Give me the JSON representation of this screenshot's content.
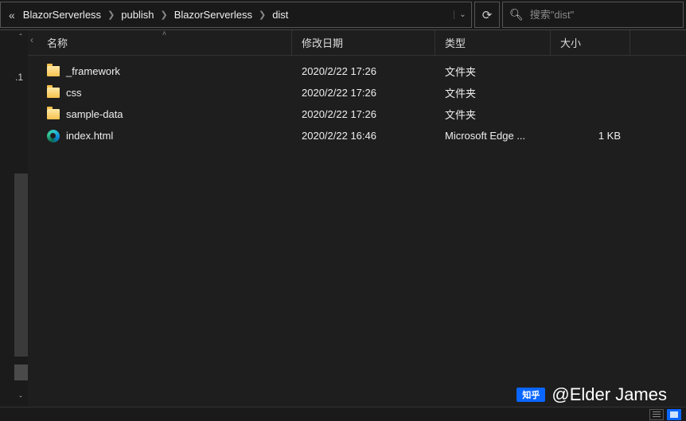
{
  "breadcrumb": {
    "overflow": "«",
    "items": [
      "BlazorServerless",
      "publish",
      "BlazorServerless",
      "dist"
    ]
  },
  "search": {
    "placeholder": "搜索\"dist\""
  },
  "left": {
    "label": ".1"
  },
  "columns": {
    "name": "名称",
    "date": "修改日期",
    "type": "类型",
    "size": "大小"
  },
  "files": [
    {
      "icon": "folder",
      "name": "_framework",
      "date": "2020/2/22 17:26",
      "type": "文件夹",
      "size": ""
    },
    {
      "icon": "folder",
      "name": "css",
      "date": "2020/2/22 17:26",
      "type": "文件夹",
      "size": ""
    },
    {
      "icon": "folder",
      "name": "sample-data",
      "date": "2020/2/22 17:26",
      "type": "文件夹",
      "size": ""
    },
    {
      "icon": "edge",
      "name": "index.html",
      "date": "2020/2/22 16:46",
      "type": "Microsoft Edge ...",
      "size": "1 KB"
    }
  ],
  "watermark": {
    "logo": "知乎",
    "text": "@Elder James"
  }
}
